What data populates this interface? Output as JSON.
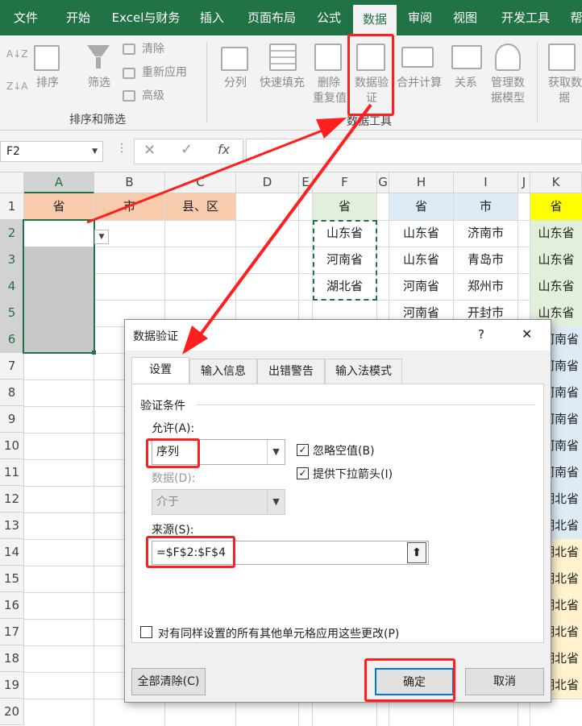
{
  "menu_tabs": [
    "文件",
    "开始",
    "Excel与财务",
    "插入",
    "页面布局",
    "公式",
    "数据",
    "审阅",
    "视图",
    "开发工具",
    "帮"
  ],
  "ribbon": {
    "sort_asc": "A↓Z",
    "sort_desc": "Z↓A",
    "sort": "排序",
    "filter": "筛选",
    "clear": "清除",
    "reapply": "重新应用",
    "advanced": "高级",
    "group_sort": "排序和筛选",
    "split": "分列",
    "flash_fill": "快速填充",
    "remove_dup_1": "删除",
    "remove_dup_2": "重复值",
    "validation_1": "数据验",
    "validation_2": "证",
    "consolidate": "合并计算",
    "relations": "关系",
    "manage_model_1": "管理数",
    "manage_model_2": "据模型",
    "get_data_1": "获取数",
    "get_data_2": "据",
    "group_tools": "数据工具"
  },
  "formula_bar": {
    "name_box": "F2",
    "cancel": "✕",
    "enter": "✓",
    "fx": "fx",
    "value": ""
  },
  "sheet": {
    "columns": [
      "A",
      "B",
      "C",
      "D",
      "E",
      "F",
      "G",
      "H",
      "I",
      "J",
      "K"
    ],
    "rows": [
      "1",
      "2",
      "3",
      "4",
      "5",
      "6",
      "7",
      "8",
      "9",
      "10",
      "11",
      "12",
      "13",
      "14",
      "15",
      "16",
      "17",
      "18",
      "19",
      "20"
    ],
    "a1": "省",
    "b1": "市",
    "c1": "县、区",
    "f1": "省",
    "f_list": [
      "山东省",
      "河南省",
      "湖北省"
    ],
    "h1": "省",
    "i1": "市",
    "h_list": [
      "山东省",
      "山东省",
      "河南省",
      "河南省"
    ],
    "i_list": [
      "济南市",
      "青岛市",
      "郑州市",
      "开封市"
    ],
    "k1": "省",
    "k_list": [
      "山东省",
      "山东省",
      "山东省",
      "山东省",
      "河南省",
      "河南省",
      "河南省",
      "河南省",
      "河南省",
      "河南省",
      "湖北省",
      "湖北省",
      "湖北省",
      "湖北省",
      "湖北省",
      "湖北省",
      "湖北省",
      "湖北省"
    ]
  },
  "dialog": {
    "title": "数据验证",
    "help": "?",
    "close": "✕",
    "tabs": [
      "设置",
      "输入信息",
      "出错警告",
      "输入法模式"
    ],
    "criteria": "验证条件",
    "allow_label": "允许(A):",
    "allow_value": "序列",
    "data_label": "数据(D):",
    "data_value": "介于",
    "ignore_blank": "忽略空值(B)",
    "dropdown": "提供下拉箭头(I)",
    "source_label": "来源(S):",
    "source_value": "=$F$2:$F$4",
    "apply_all": "对有同样设置的所有其他单元格应用这些更改(P)",
    "clear_all": "全部清除(C)",
    "ok": "确定",
    "cancel": "取消"
  },
  "colors": {
    "excel_green": "#217346",
    "header_orange": "#f8cbad",
    "header_green": "#e2efda",
    "header_blue": "#ddebf7",
    "header_yellow": "#ffff00",
    "annotation_red": "#ff1f1f"
  }
}
